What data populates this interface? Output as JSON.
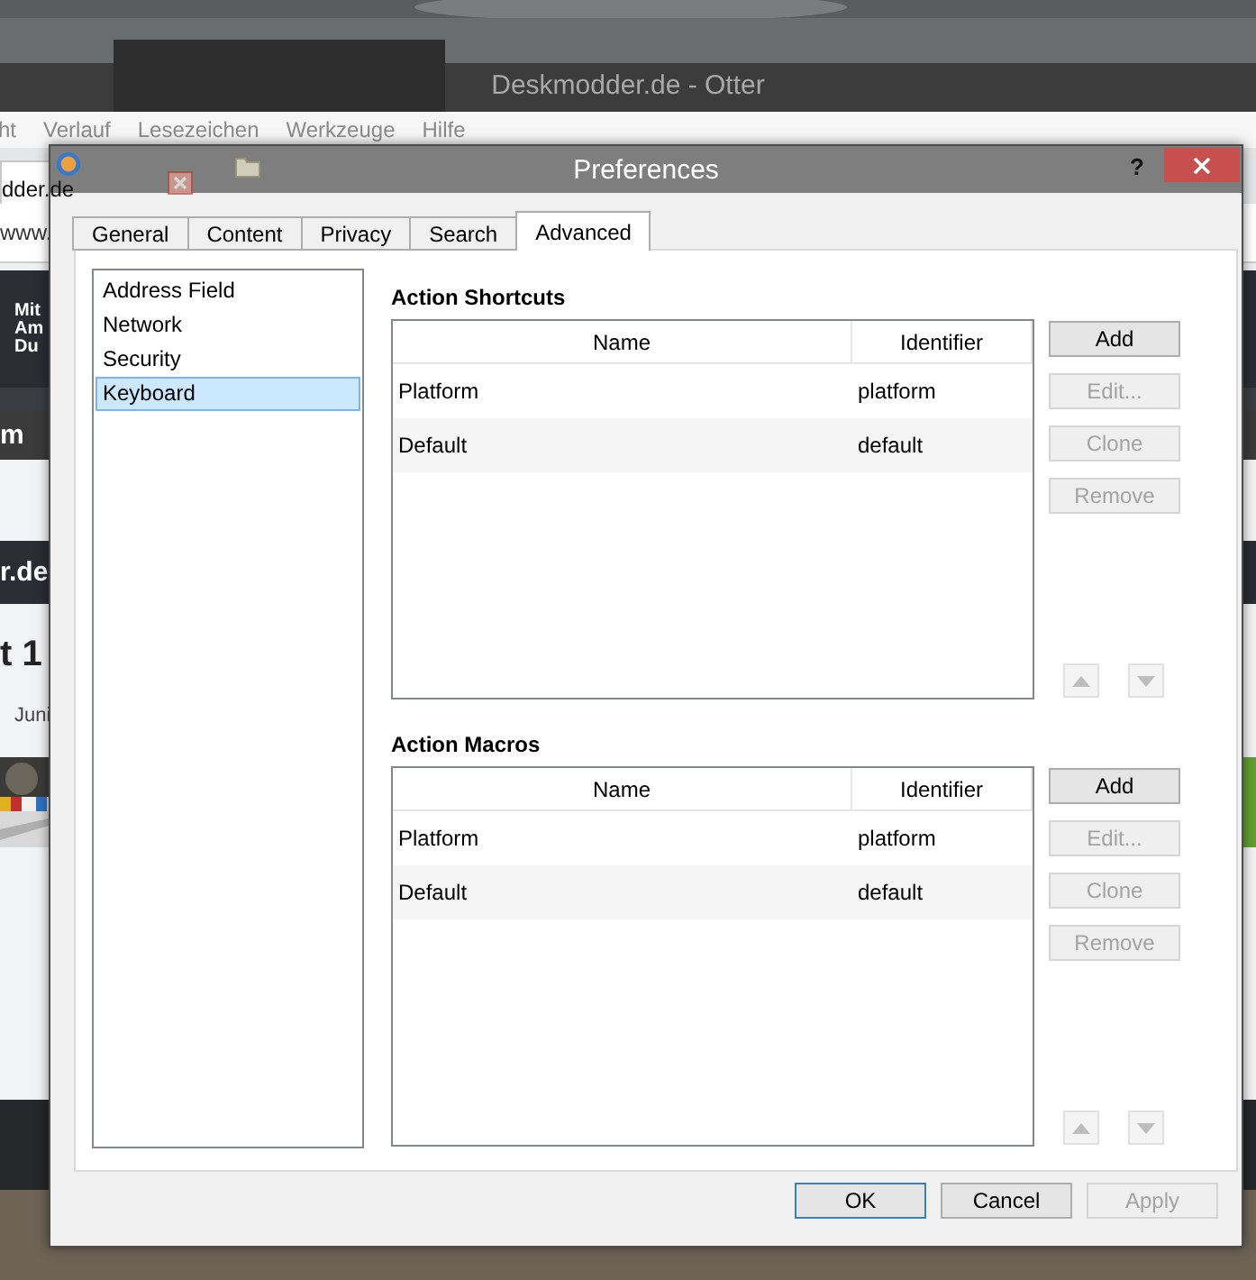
{
  "browser": {
    "title": "Deskmodder.de - Otter",
    "menu": [
      "ht",
      "Verlauf",
      "Lesezeichen",
      "Werkzeuge",
      "Hilfe"
    ],
    "tab": "dder.de",
    "address": "www.",
    "banner_lines": [
      "Mit",
      "Am",
      "Du"
    ],
    "nav_item": "m",
    "site_name": "r.de",
    "headline": "t 1",
    "date": "Juni"
  },
  "dialog": {
    "title": "Preferences",
    "help": "?",
    "tabs": [
      {
        "label": "General",
        "selected": false
      },
      {
        "label": "Content",
        "selected": false
      },
      {
        "label": "Privacy",
        "selected": false
      },
      {
        "label": "Search",
        "selected": false
      },
      {
        "label": "Advanced",
        "selected": true
      }
    ],
    "sidebar": [
      {
        "label": "Address Field",
        "selected": false
      },
      {
        "label": "Network",
        "selected": false
      },
      {
        "label": "Security",
        "selected": false
      },
      {
        "label": "Keyboard",
        "selected": true
      }
    ],
    "sections": [
      {
        "title": "Action Shortcuts",
        "columns": [
          "Name",
          "Identifier"
        ],
        "rows": [
          [
            "Platform",
            "platform"
          ],
          [
            "Default",
            "default"
          ]
        ],
        "buttons": [
          {
            "label": "Add",
            "disabled": false
          },
          {
            "label": "Edit...",
            "disabled": true
          },
          {
            "label": "Clone",
            "disabled": true
          },
          {
            "label": "Remove",
            "disabled": true
          }
        ],
        "arrows": [
          {
            "kind": "up",
            "disabled": true
          },
          {
            "kind": "down",
            "disabled": true
          }
        ]
      },
      {
        "title": "Action Macros",
        "columns": [
          "Name",
          "Identifier"
        ],
        "rows": [
          [
            "Platform",
            "platform"
          ],
          [
            "Default",
            "default"
          ]
        ],
        "buttons": [
          {
            "label": "Add",
            "disabled": false
          },
          {
            "label": "Edit...",
            "disabled": true
          },
          {
            "label": "Clone",
            "disabled": true
          },
          {
            "label": "Remove",
            "disabled": true
          }
        ],
        "arrows": [
          {
            "kind": "up",
            "disabled": true
          },
          {
            "kind": "down",
            "disabled": true
          }
        ]
      }
    ],
    "footer_buttons": [
      {
        "label": "OK",
        "default": true,
        "disabled": false
      },
      {
        "label": "Cancel",
        "default": false,
        "disabled": false
      },
      {
        "label": "Apply",
        "default": false,
        "disabled": true
      }
    ]
  }
}
